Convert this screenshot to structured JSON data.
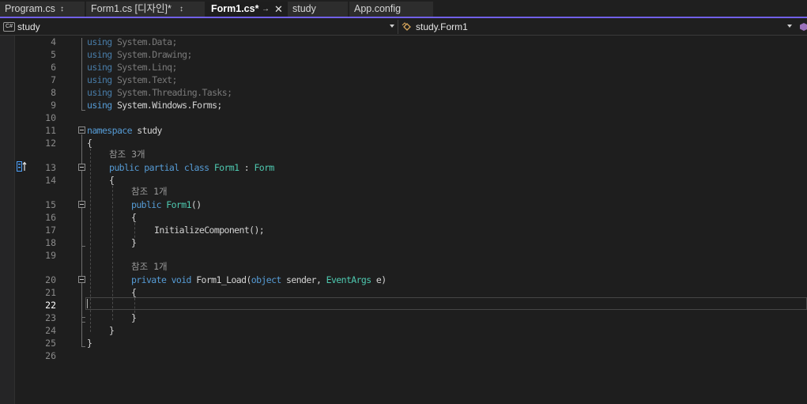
{
  "tabs": [
    {
      "label": "Program.cs",
      "pin": "↕"
    },
    {
      "label": "Form1.cs [디자인]*",
      "pin": "↕"
    },
    {
      "label": "Form1.cs*",
      "pin": "→",
      "close": "✕"
    },
    {
      "label": "study"
    },
    {
      "label": "App.config"
    }
  ],
  "nav": {
    "project_badge": "C#",
    "project": "study",
    "class": "study.Form1"
  },
  "colors": {
    "accent": "#7160e8",
    "keyword": "#569cd6",
    "type": "#4ec9b0",
    "text": "#d4d4d4"
  },
  "editor": {
    "line_numbers": [
      "4",
      "5",
      "6",
      "7",
      "8",
      "9",
      "10",
      "11",
      "12",
      "13",
      "14",
      "15",
      "16",
      "17",
      "18",
      "19",
      "20",
      "21",
      "22",
      "23",
      "24",
      "25",
      "26"
    ],
    "current_line": "22",
    "lines": {
      "l4": {
        "kw": "using",
        "rest": " System.Data;"
      },
      "l5": {
        "kw": "using",
        "rest": " System.Drawing;"
      },
      "l6": {
        "kw": "using",
        "rest": " System.Linq;"
      },
      "l7": {
        "kw": "using",
        "rest": " System.Text;"
      },
      "l8": {
        "kw": "using",
        "rest": " System.Threading.Tasks;"
      },
      "l9": {
        "kw": "using",
        "rest": " System.Windows.Forms;"
      },
      "l11": {
        "kw": "namespace",
        "rest": " study"
      },
      "l12": {
        "text": "{"
      },
      "l13": {
        "kw1": "public",
        "kw2": " partial",
        "kw3": " class",
        "name": " Form1",
        "sep": " : ",
        "base": "Form"
      },
      "l14": {
        "text": "{"
      },
      "l15": {
        "kw": "public",
        "name": " Form1",
        "rest": "()"
      },
      "l16": {
        "text": "{"
      },
      "l17": {
        "text": "InitializeComponent();"
      },
      "l18": {
        "text": "}"
      },
      "l20": {
        "kw1": "private",
        "kw2": " void",
        "name": " Form1_Load(",
        "kw3": "object",
        "p1": " sender, ",
        "ty": "EventArgs",
        "p2": " e)"
      },
      "l21": {
        "text": "{"
      },
      "l23": {
        "text": "}"
      },
      "l24": {
        "text": "}"
      },
      "l25": {
        "text": "}"
      }
    },
    "codelens": {
      "class_refs": "참조 3개",
      "ctor_refs": "참조 1개",
      "load_refs": "참조 1개"
    }
  }
}
